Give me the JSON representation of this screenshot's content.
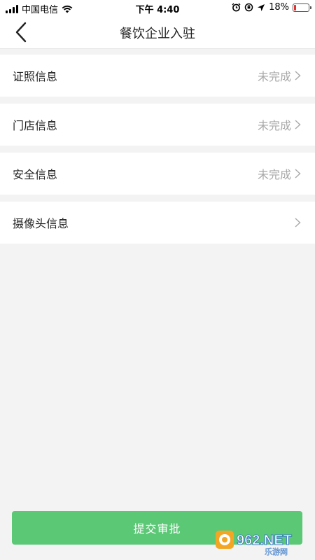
{
  "status_bar": {
    "carrier": "中国电信",
    "time": "下午 4:40",
    "battery": "18%",
    "battery_level": 0.18,
    "icons": [
      "signal-icon",
      "wifi-icon",
      "alarm-icon",
      "orientation-lock-icon",
      "location-arrow-icon",
      "battery-icon"
    ]
  },
  "header": {
    "title": "餐饮企业入驻"
  },
  "menu": {
    "items": [
      {
        "label": "证照信息",
        "status": "未完成"
      },
      {
        "label": "门店信息",
        "status": "未完成"
      },
      {
        "label": "安全信息",
        "status": "未完成"
      },
      {
        "label": "摄像头信息",
        "status": ""
      }
    ]
  },
  "footer": {
    "submit_label": "提交审批"
  },
  "watermark": {
    "brand": "962.NET",
    "subtitle": "乐游网"
  },
  "colors": {
    "primary": "#5bc876",
    "background": "#f3f3f3",
    "muted_text": "#a8a8a8",
    "battery_low": "#e03030"
  }
}
